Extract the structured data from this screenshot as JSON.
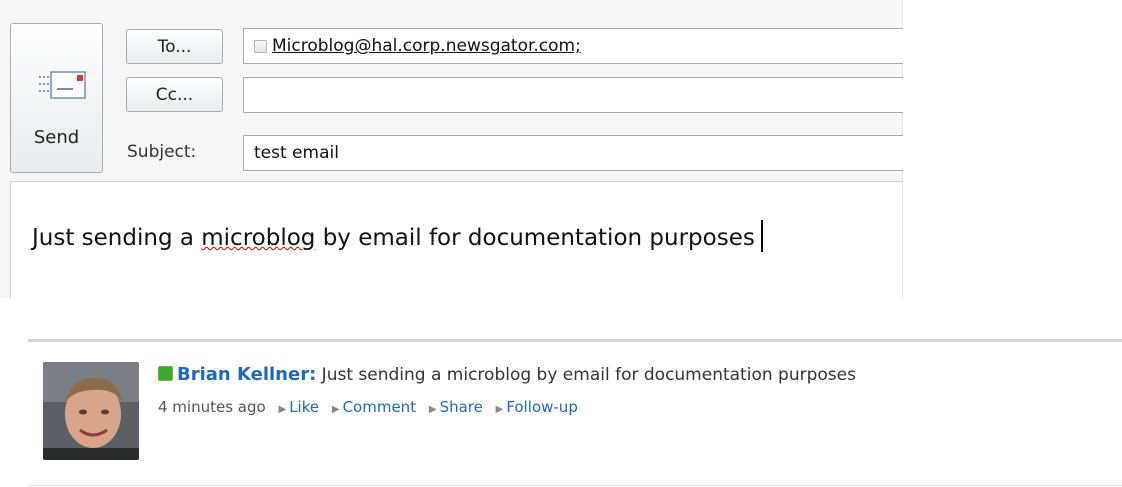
{
  "compose": {
    "send_label": "Send",
    "to_button": "To...",
    "cc_button": "Cc...",
    "subject_label": "Subject:",
    "to_value": "Microblog@hal.corp.newsgator.com;",
    "cc_value": "",
    "subject_value": "test email",
    "body_before": "Just sending a ",
    "body_misspelled": "microblog",
    "body_after": " by email for documentation purposes"
  },
  "feed": {
    "author": "Brian Kellner",
    "separator": ":",
    "message": " Just sending a microblog by email for documentation purposes",
    "time": "4 minutes ago",
    "actions": [
      "Like",
      "Comment",
      "Share",
      "Follow-up"
    ],
    "presence_color": "#3aa82c",
    "link_color": "#1f6ab8"
  }
}
